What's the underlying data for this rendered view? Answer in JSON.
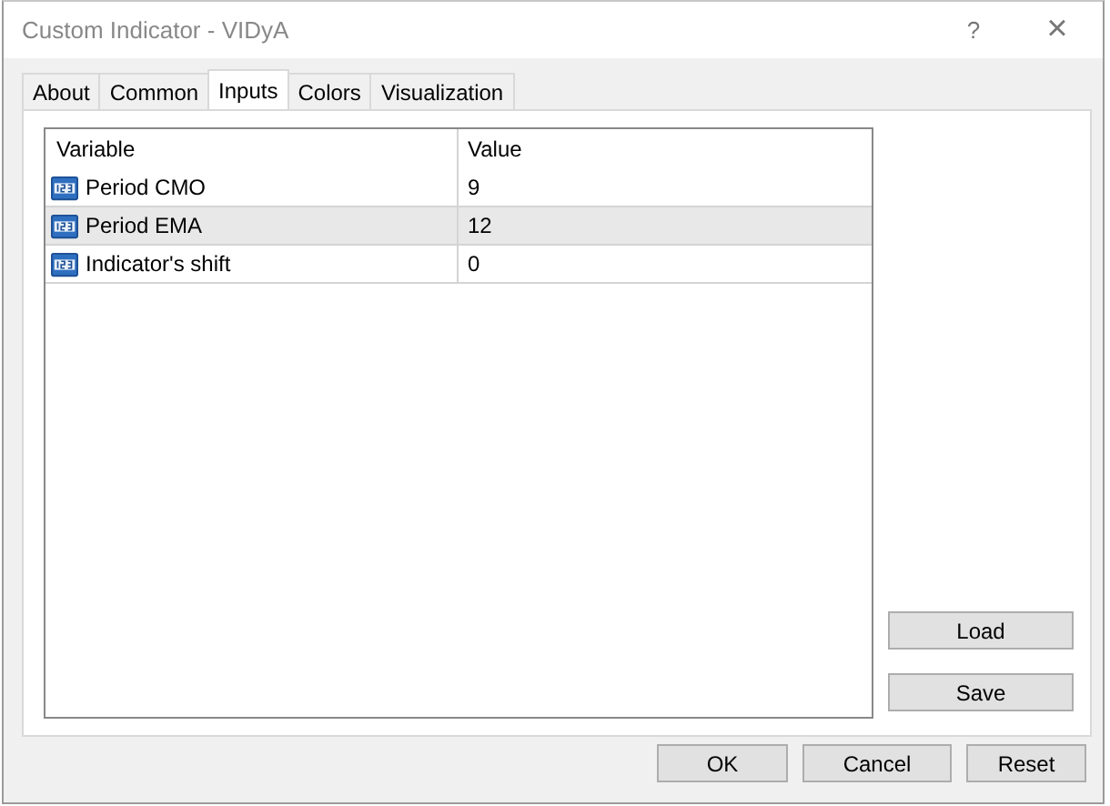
{
  "window": {
    "title": "Custom Indicator - VIDyA",
    "help": "?",
    "close": "×"
  },
  "tabs": [
    {
      "label": "About",
      "selected": false
    },
    {
      "label": "Common",
      "selected": false
    },
    {
      "label": "Inputs",
      "selected": true
    },
    {
      "label": "Colors",
      "selected": false
    },
    {
      "label": "Visualization",
      "selected": false
    }
  ],
  "table": {
    "columns": [
      "Variable",
      "Value"
    ],
    "rows": [
      {
        "variable": "Period CMO",
        "value": "9",
        "selected": false
      },
      {
        "variable": "Period EMA",
        "value": "12",
        "selected": true
      },
      {
        "variable": "Indicator's shift",
        "value": "0",
        "selected": false
      }
    ]
  },
  "side_buttons": [
    "Load",
    "Save"
  ],
  "buttons": [
    "OK",
    "Cancel",
    "Reset"
  ]
}
